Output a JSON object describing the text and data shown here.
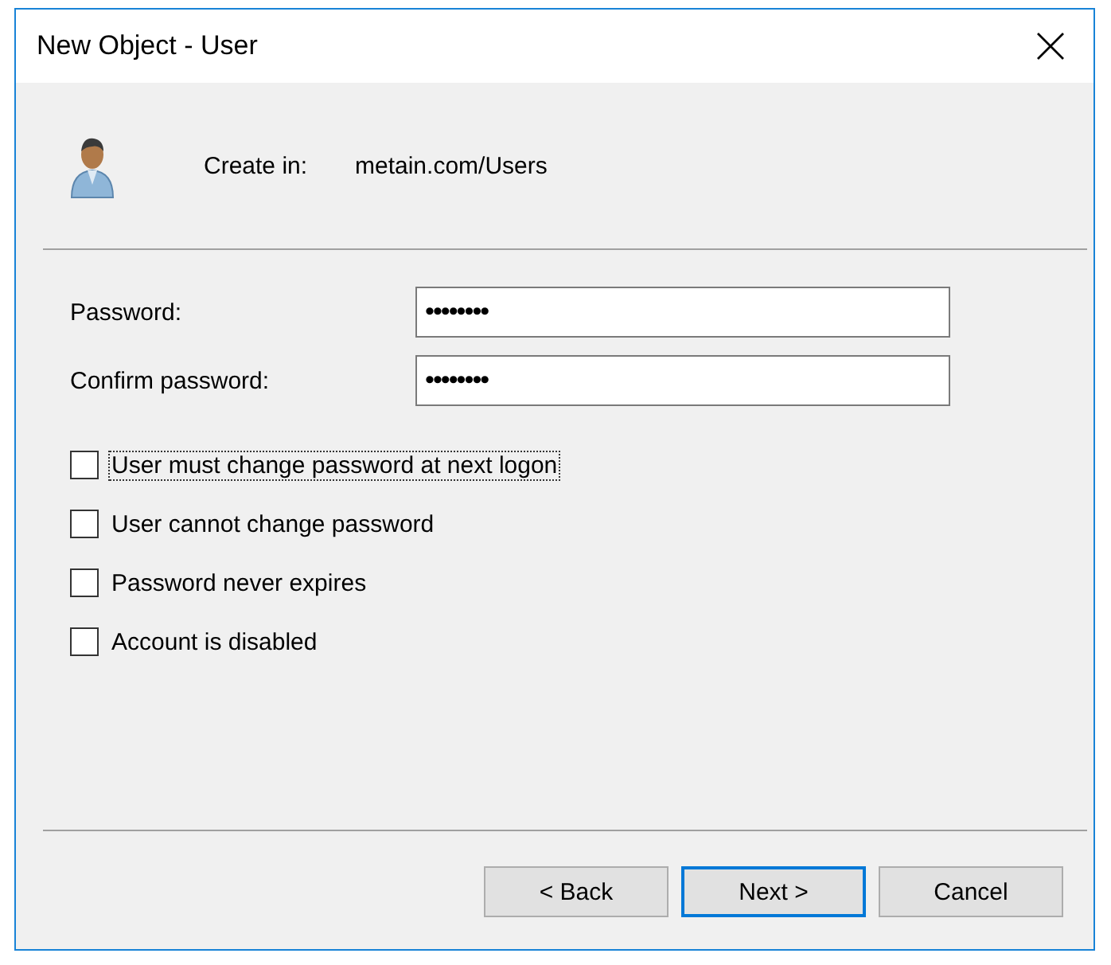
{
  "window": {
    "title": "New Object - User"
  },
  "create_in": {
    "label": "Create in:",
    "value": "metain.com/Users"
  },
  "fields": [
    {
      "label": "Password:",
      "value": "••••••••"
    },
    {
      "label": "Confirm password:",
      "value": "••••••••"
    }
  ],
  "options": [
    {
      "label": "User must change password at next logon",
      "checked": false,
      "focused": true
    },
    {
      "label": "User cannot change password",
      "checked": false,
      "focused": false
    },
    {
      "label": "Password never expires",
      "checked": false,
      "focused": false
    },
    {
      "label": "Account is disabled",
      "checked": false,
      "focused": false
    }
  ],
  "buttons": [
    {
      "label": "< Back",
      "default": false
    },
    {
      "label": "Next >",
      "default": true
    },
    {
      "label": "Cancel",
      "default": false
    }
  ]
}
